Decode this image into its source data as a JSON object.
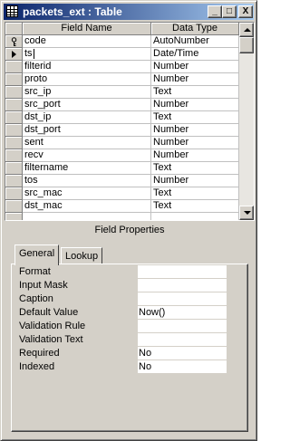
{
  "window": {
    "title": "packets_ext : Table",
    "controls": {
      "minimize": "_",
      "maximize": "□",
      "close": "X"
    }
  },
  "grid": {
    "headers": {
      "field_name": "Field Name",
      "data_type": "Data Type"
    },
    "rows": [
      {
        "name": "code",
        "type": "AutoNumber",
        "indicator": "key-icon"
      },
      {
        "name": "ts",
        "type": "Date/Time",
        "indicator": "current-row-arrow-icon"
      },
      {
        "name": "filterid",
        "type": "Number"
      },
      {
        "name": "proto",
        "type": "Number"
      },
      {
        "name": "src_ip",
        "type": "Text"
      },
      {
        "name": "src_port",
        "type": "Number"
      },
      {
        "name": "dst_ip",
        "type": "Text"
      },
      {
        "name": "dst_port",
        "type": "Number"
      },
      {
        "name": "sent",
        "type": "Number"
      },
      {
        "name": "recv",
        "type": "Number"
      },
      {
        "name": "filtername",
        "type": "Text"
      },
      {
        "name": "tos",
        "type": "Number"
      },
      {
        "name": "src_mac",
        "type": "Text"
      },
      {
        "name": "dst_mac",
        "type": "Text"
      },
      {
        "name": "",
        "type": ""
      }
    ]
  },
  "field_properties": {
    "label": "Field Properties",
    "tabs": {
      "general": "General",
      "lookup": "Lookup"
    },
    "active_tab": "General",
    "properties": [
      {
        "label": "Format",
        "value": ""
      },
      {
        "label": "Input Mask",
        "value": ""
      },
      {
        "label": "Caption",
        "value": ""
      },
      {
        "label": "Default Value",
        "value": "Now()"
      },
      {
        "label": "Validation Rule",
        "value": ""
      },
      {
        "label": "Validation Text",
        "value": ""
      },
      {
        "label": "Required",
        "value": "No"
      },
      {
        "label": "Indexed",
        "value": "No"
      }
    ]
  }
}
